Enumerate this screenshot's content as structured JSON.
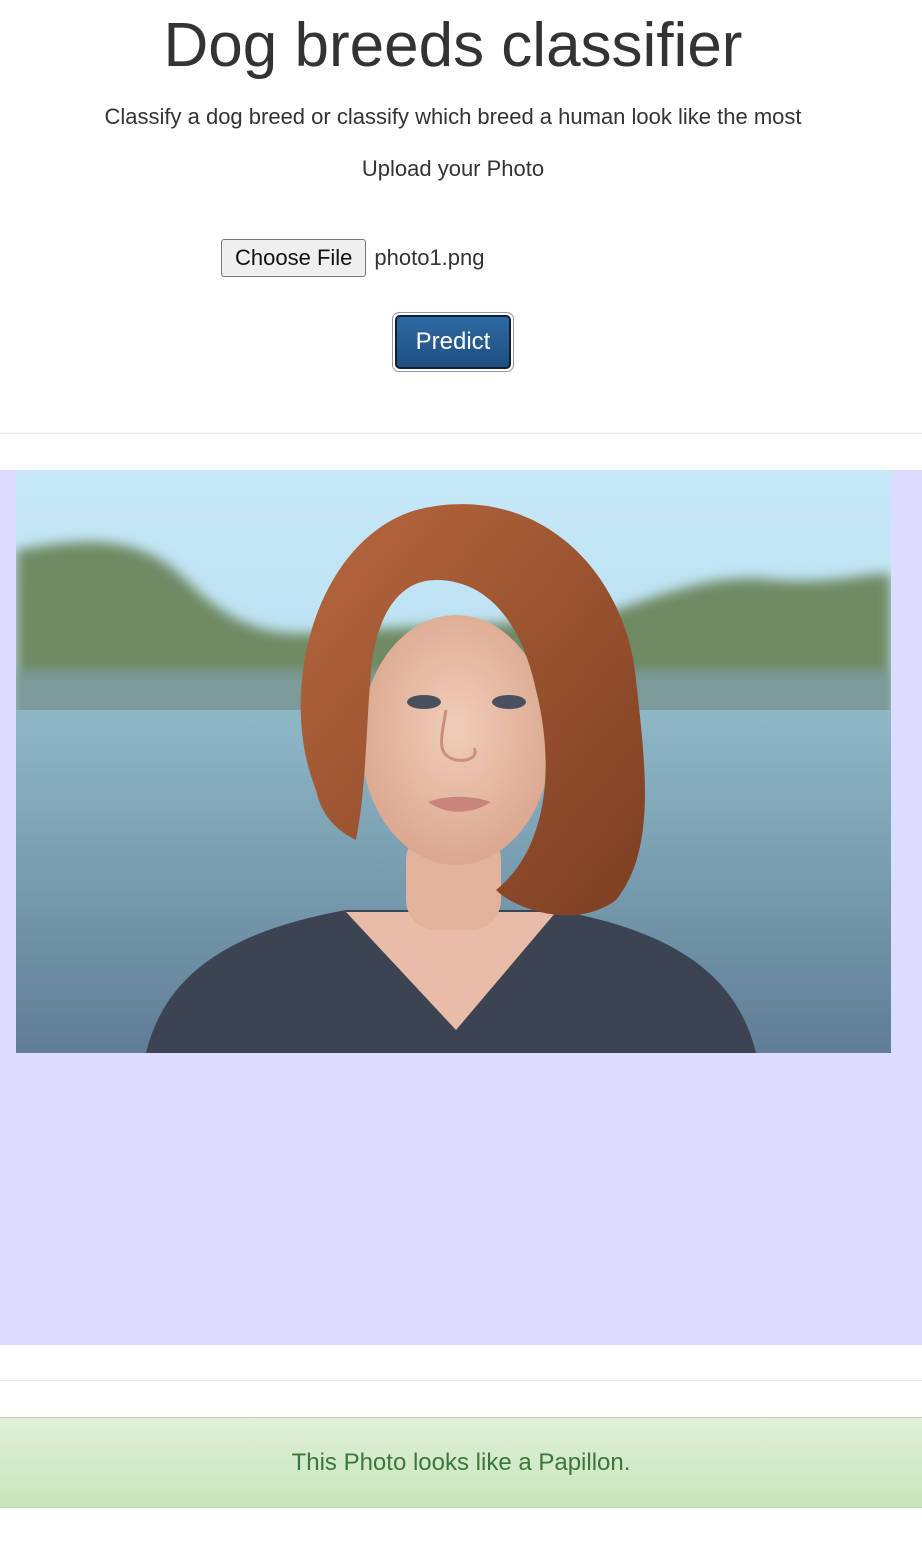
{
  "header": {
    "title": "Dog breeds classifier",
    "subtitle": "Classify a dog breed or classify which breed a human look like the most",
    "upload_label": "Upload your Photo"
  },
  "upload": {
    "choose_file_label": "Choose File",
    "selected_file": "photo1.png",
    "predict_label": "Predict"
  },
  "preview": {
    "image_description": "portrait-photo",
    "panel_color": "#dcdcff"
  },
  "result": {
    "message": "This Photo looks like a Papillon.",
    "color": "#3c763d"
  },
  "colors": {
    "predict_button": "#245a8e",
    "alert_background": "#dff0d8"
  }
}
